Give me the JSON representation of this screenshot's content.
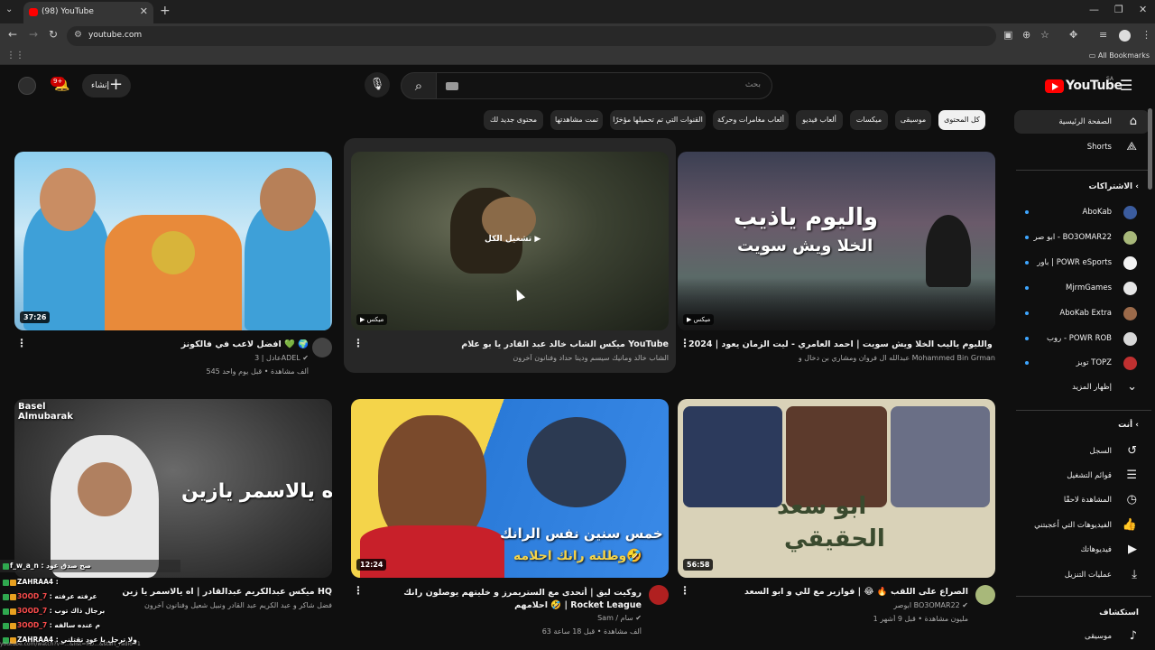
{
  "browser": {
    "tab_title": "(98) YouTube",
    "url": "youtube.com",
    "all_bookmarks": "All Bookmarks"
  },
  "masthead": {
    "logo_text": "YouTube",
    "region": "SA",
    "search_placeholder": "بحث",
    "create_label": "إنشاء",
    "notifications": "9+"
  },
  "chips": [
    "كل المحتوى",
    "موسيقى",
    "ميكسات",
    "ألعاب فيديو",
    "ألعاب مغامرات وحركة",
    "القنوات التي تم تحميلها مؤخرًا",
    "تمت مشاهدتها",
    "محتوى جديد لك"
  ],
  "sidebar": {
    "main": [
      {
        "label": "الصفحة الرئيسية",
        "icon": "home-icon"
      },
      {
        "label": "Shorts",
        "icon": "shorts-icon"
      }
    ],
    "subscriptions_title": "الاشتراكات",
    "subscriptions": [
      {
        "label": "AboKab",
        "color": "#3b5c9e"
      },
      {
        "label": "ابو صر - BO3OMAR22",
        "color": "#a8b87a"
      },
      {
        "label": "باور | POWR eSports",
        "color": "#d43a3a"
      },
      {
        "label": "MjrmGames",
        "color": "#222222"
      },
      {
        "label": "AboKab Extra",
        "color": "#9b6a4a"
      },
      {
        "label": "روب - POWR ROB",
        "color": "#d8d8d8"
      },
      {
        "label": "توبز TOPZ",
        "color": "#c03030"
      }
    ],
    "show_more": "إظهار المزيد",
    "you_title": "أنت",
    "you_items": [
      {
        "label": "السجل",
        "icon": "history-icon"
      },
      {
        "label": "قوائم التشغيل",
        "icon": "playlists-icon"
      },
      {
        "label": "المشاهدة لاحقًا",
        "icon": "watch-later-icon"
      },
      {
        "label": "الفيديوهات التي أعجبتني",
        "icon": "like-icon"
      },
      {
        "label": "فيديوهاتك",
        "icon": "your-videos-icon"
      },
      {
        "label": "عمليات التنزيل",
        "icon": "download-icon"
      }
    ],
    "explore_title": "استكشاف",
    "explore_items": [
      {
        "label": "موسيقى",
        "icon": "music-icon"
      }
    ]
  },
  "videos": [
    {
      "title": "ميكس والليوم ياليب الخلا ويش سويت | احمد العامري - ليت الزمان يعود | 2024",
      "channel": "عبدالله ال فروان ومشاري بن دخال و Mohammed Bin Grman",
      "meta": "",
      "duration": "",
      "badge": "ميكس",
      "thumb_text_1": "واليوم ياذيب",
      "thumb_text_2": "الخلا ويش سويت"
    },
    {
      "title": "ميكس الشاب خالد عبد القادر يا بو علام YouTube",
      "channel": "الشاب خالد ومانيك سيسم ودينا حداد وفنانون آخرون",
      "meta": "",
      "duration": "",
      "badge": "ميكس",
      "hover_label": "تشغيل الكل",
      "thumb_text_1": "",
      "thumb_text_2": ""
    },
    {
      "title": "افضل لاعب في فالكونز 💚 🌍",
      "channel": "عادل | 3ADEL",
      "meta": "545 ألف مشاهدة • قبل يوم واحد",
      "duration": "37:26",
      "badge": "",
      "thumb_text_1": "",
      "thumb_text_2": ""
    },
    {
      "title": "الصراع على اللقب 🔥 😂 | فوازير مع للي و ابو السعد",
      "channel": "ابوصر BO3OMAR22",
      "meta": "1 مليون مشاهدة • قبل 9 أشهر",
      "duration": "56:58",
      "badge": "",
      "thumb_text_1": "ابو سعد",
      "thumb_text_2": "الحقيقي"
    },
    {
      "title": "روكيت ليق | أتحدى مع الستريمرز و خليتهم يوصلون رانك احلامهم 🤣 | Rocket League",
      "channel": "Sam / سام",
      "meta": "63 ألف مشاهدة • قبل 18 ساعة",
      "duration": "12:24",
      "badge": "",
      "thumb_text_1": "خمس سنين نفس الرانك !",
      "thumb_text_2": "وطلته رانك احلامه🤣"
    },
    {
      "title": "ميكس عبدالكريم عبدالقادر | آه يالاسمر يا زين HQ",
      "channel": "فضل شاكر و عبد الكريم عبد القادر ونبيل شعيل وفنانون آخرون",
      "meta": "",
      "duration": "",
      "badge": "",
      "thumb_text_1": "آه يالاسمر يازين",
      "thumb_text_2": "Basel Almubarak"
    }
  ],
  "chat": [
    {
      "user": "f_w_a_n",
      "msg": "صح صدق عود"
    },
    {
      "user": "ZAHRAA4",
      "msg": ""
    },
    {
      "user": "3OOD_7",
      "msg": "عرفته عرفته"
    },
    {
      "user": "3OOD_7",
      "msg": "برجال ذاك توب"
    },
    {
      "user": "3OOD_7",
      "msg": "م عنده سالفه"
    },
    {
      "user": "ZAHRAA4",
      "msg": "ولا ترحل يا عود تقتلني"
    }
  ],
  "status_url": "youtube.com/watch?v=...&list=RD...&start_radio=1"
}
